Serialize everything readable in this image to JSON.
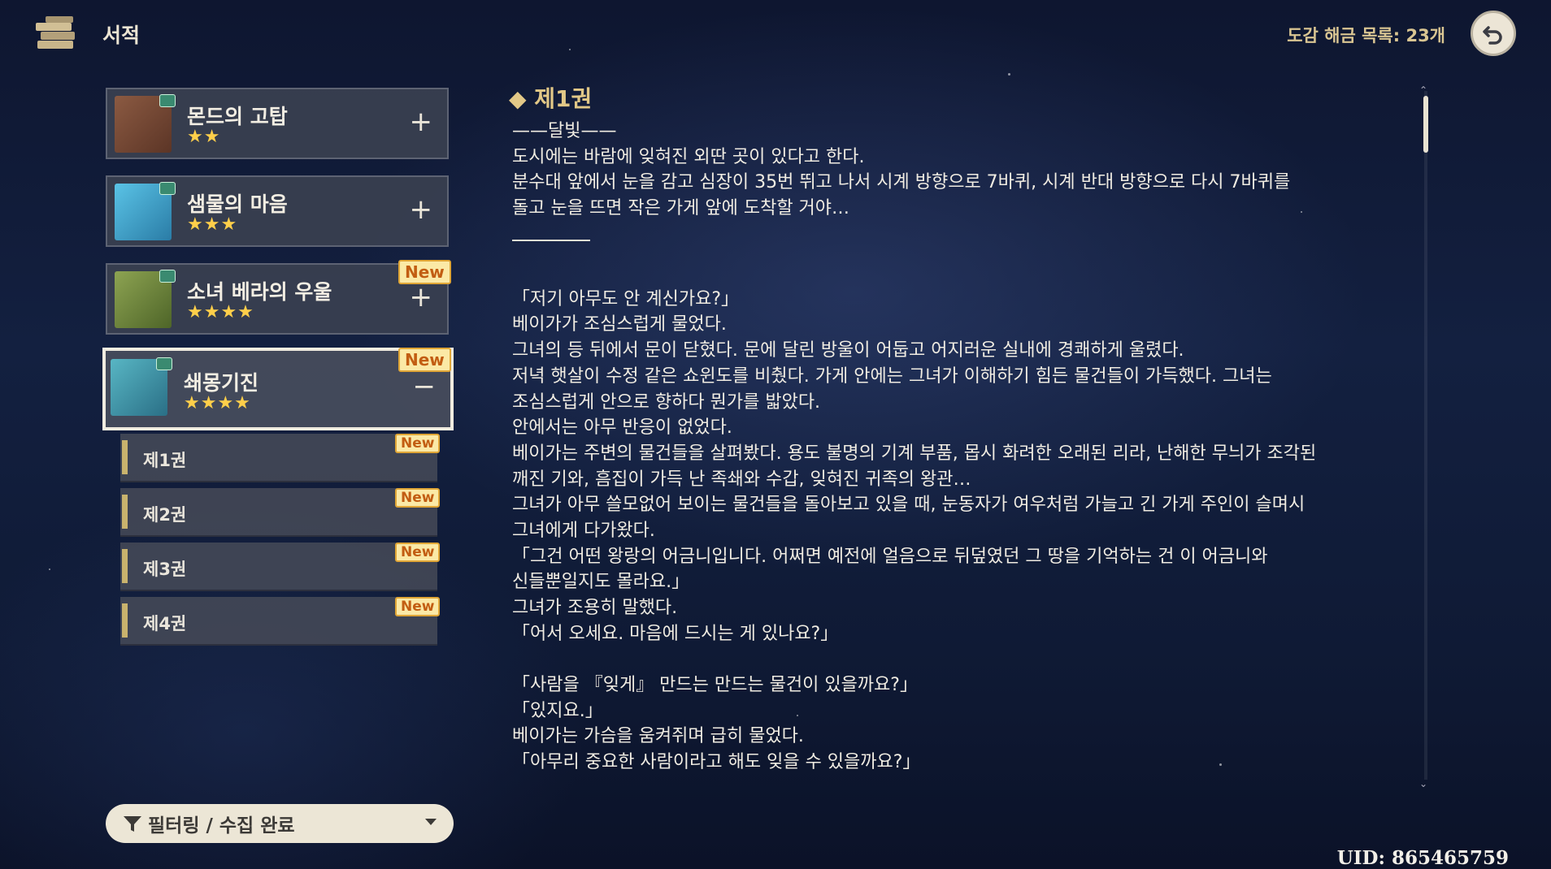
{
  "header": {
    "title": "서적",
    "unlock_label": "도감 해금 목록: 23개"
  },
  "books": [
    {
      "title": "몬드의 고탑",
      "stars": "★★",
      "toggle": "+",
      "new": "",
      "cover_color": "#7a4a36"
    },
    {
      "title": "샘물의 마음",
      "stars": "★★★",
      "toggle": "+",
      "new": "",
      "cover_color": "#3aa0c8"
    },
    {
      "title": "소녀 베라의 우울",
      "stars": "★★★★",
      "toggle": "+",
      "new": "New",
      "cover_color": "#6c8a3c"
    },
    {
      "title": "쇄몽기진",
      "stars": "★★★★",
      "toggle": "−",
      "new": "New",
      "cover_color": "#2f8a9c"
    }
  ],
  "volumes": [
    {
      "label": "제1권",
      "new": "New"
    },
    {
      "label": "제2권",
      "new": "New"
    },
    {
      "label": "제3권",
      "new": "New"
    },
    {
      "label": "제4권",
      "new": "New"
    }
  ],
  "filter": {
    "label": "필터링 / 수집 완료"
  },
  "reader": {
    "chapter": "◆ 제1권",
    "intro": [
      "——달빛——",
      "도시에는 바람에 잊혀진 외딴 곳이 있다고 한다.",
      "분수대 앞에서 눈을 감고 심장이 35번 뛰고 나서 시계 방향으로 7바퀴, 시계 반대 방향으로 다시 7바퀴를",
      "돌고 눈을 뜨면 작은 가게 앞에 도착할 거야…"
    ],
    "body": [
      "「저기 아무도 안 계신가요?」",
      "베이가가 조심스럽게 물었다.",
      "그녀의 등 뒤에서 문이 닫혔다. 문에 달린 방울이 어둡고 어지러운 실내에 경쾌하게 울렸다.",
      "저녁 햇살이 수정 같은 쇼윈도를 비췄다. 가게 안에는 그녀가 이해하기 힘든 물건들이 가득했다. 그녀는",
      "조심스럽게 안으로 향하다 뭔가를 밟았다.",
      "안에서는 아무 반응이 없었다.",
      "베이가는 주변의 물건들을 살펴봤다. 용도 불명의 기계 부품, 몹시 화려한 오래된 리라, 난해한 무늬가 조각된",
      "깨진 기와, 흠집이 가득 난 족쇄와 수갑, 잊혀진 귀족의 왕관…",
      "그녀가 아무 쓸모없어 보이는 물건들을 돌아보고 있을 때, 눈동자가 여우처럼 가늘고 긴 가게 주인이 슬며시",
      "그녀에게 다가왔다.",
      "「그건 어떤 왕랑의 어금니입니다. 어쩌면 예전에 얼음으로 뒤덮였던 그 땅을 기억하는 건 이 어금니와",
      "신들뿐일지도 몰라요.」",
      "그녀가 조용히 말했다.",
      "「어서 오세요. 마음에 드시는 게 있나요?」",
      "",
      "「사람을 『잊게』 만드는 만드는 물건이 있을까요?」",
      "「있지요.」",
      "베이가는 가슴을 움켜쥐며 급히 물었다.",
      "「아무리 중요한 사람이라고 해도 잊을 수 있을까요?」"
    ]
  },
  "uid": "UID: 865465759"
}
